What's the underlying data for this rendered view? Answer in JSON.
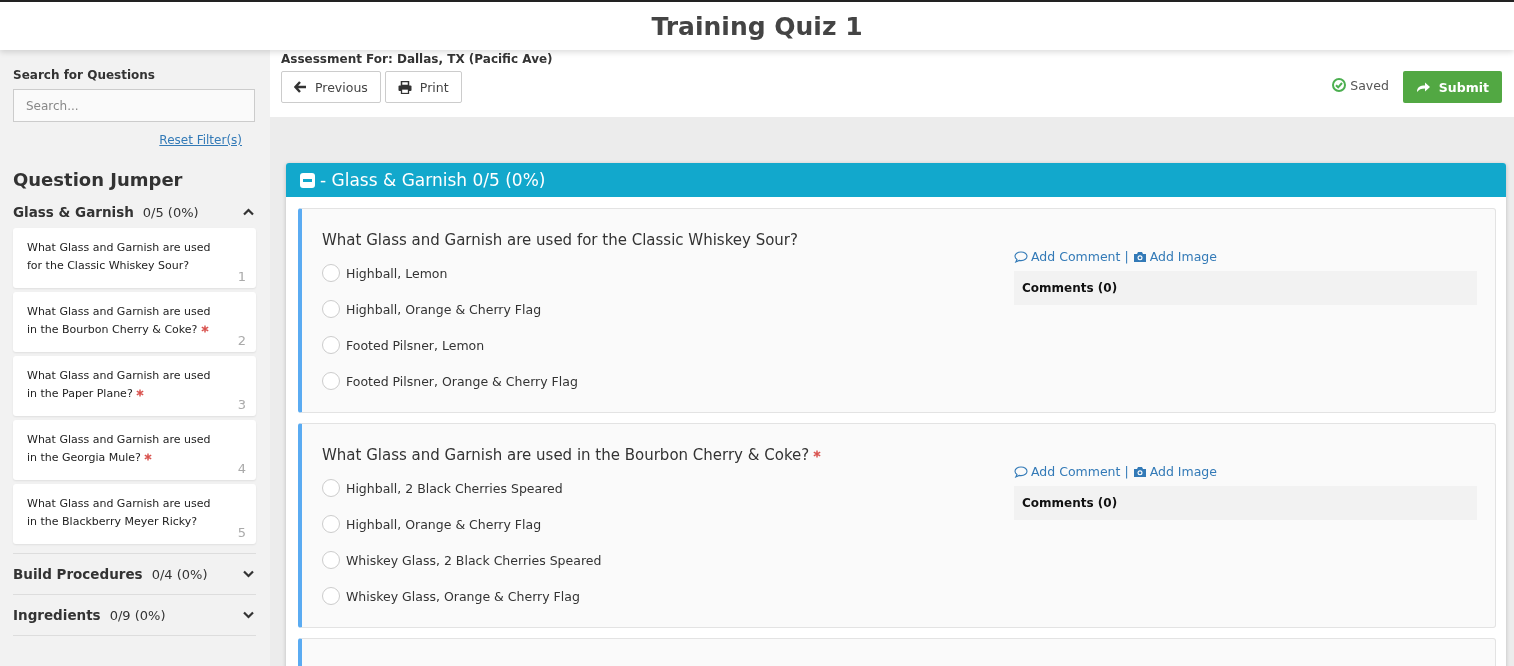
{
  "title": "Training Quiz 1",
  "sidebar": {
    "search_label": "Search for Questions",
    "search": {
      "placeholder": "Search..."
    },
    "reset_link": "Reset Filter(s)",
    "jumper_title": "Question Jumper",
    "sections": [
      {
        "name": "Glass & Garnish",
        "score": "0/5 (0%)",
        "expanded": true,
        "items": [
          {
            "text": "What Glass and Garnish are used for the Classic Whiskey Sour?",
            "required": false,
            "number": "1"
          },
          {
            "text": "What Glass and Garnish are used in the Bourbon Cherry & Coke?",
            "required": true,
            "number": "2"
          },
          {
            "text": "What Glass and Garnish are used in the Paper Plane?",
            "required": true,
            "number": "3"
          },
          {
            "text": "What Glass and Garnish are used in the Georgia Mule?",
            "required": true,
            "number": "4"
          },
          {
            "text": "What Glass and Garnish are used in the Blackberry Meyer Ricky?",
            "required": false,
            "number": "5"
          }
        ]
      },
      {
        "name": "Build Procedures",
        "score": "0/4 (0%)",
        "expanded": false
      },
      {
        "name": "Ingredients",
        "score": "0/9 (0%)",
        "expanded": false
      }
    ]
  },
  "toolbar": {
    "assessment": "Assessment For: Dallas, TX (Pacific Ave)",
    "buttons": [
      "Previous",
      "Print"
    ],
    "status": "Saved",
    "submit": "Submit"
  },
  "section_panel": {
    "title": "- Glass & Garnish 0/5 (0%)",
    "expanded": true,
    "questions": [
      {
        "text": "What Glass and Garnish are used for the Classic Whiskey Sour?",
        "required": false,
        "options": [
          {
            "label": "Highball, Lemon",
            "selected": false
          },
          {
            "label": "Highball, Orange & Cherry Flag",
            "selected": false
          },
          {
            "label": "Footed Pilsner, Lemon",
            "selected": false
          },
          {
            "label": "Footed Pilsner, Orange & Cherry Flag",
            "selected": false
          }
        ],
        "add_comment": "Add Comment",
        "separator": "|",
        "add_image": "Add Image",
        "comments": "Comments (0)"
      },
      {
        "text": "What Glass and Garnish are used in the Bourbon Cherry & Coke?",
        "required": true,
        "options": [
          {
            "label": "Highball, 2 Black Cherries Speared",
            "selected": false
          },
          {
            "label": "Highball, Orange & Cherry Flag",
            "selected": false
          },
          {
            "label": "Whiskey Glass, 2 Black Cherries Speared",
            "selected": false
          },
          {
            "label": "Whiskey Glass, Orange & Cherry Flag",
            "selected": false
          }
        ],
        "add_comment": "Add Comment",
        "separator": "|",
        "add_image": "Add Image",
        "comments": "Comments (0)"
      }
    ]
  }
}
